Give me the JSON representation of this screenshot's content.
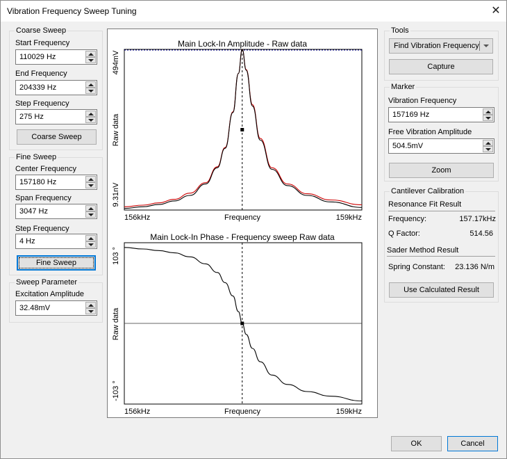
{
  "window": {
    "title": "Vibration Frequency Sweep Tuning",
    "close_glyph": "✕"
  },
  "coarse_sweep": {
    "title": "Coarse Sweep",
    "start_label": "Start Frequency",
    "start_value": "110029 Hz",
    "end_label": "End Frequency",
    "end_value": "204339 Hz",
    "step_label": "Step Frequency",
    "step_value": "275 Hz",
    "button": "Coarse Sweep"
  },
  "fine_sweep": {
    "title": "Fine Sweep",
    "center_label": "Center Frequency",
    "center_value": "157180 Hz",
    "span_label": "Span Frequency",
    "span_value": "3047 Hz",
    "step_label": "Step Frequency",
    "step_value": "4 Hz",
    "button": "Fine Sweep"
  },
  "sweep_parameter": {
    "title": "Sweep Parameter",
    "excitation_label": "Excitation Amplitude",
    "excitation_value": "32.48mV"
  },
  "tools": {
    "title": "Tools",
    "selected": "Find Vibration Frequency",
    "capture_button": "Capture"
  },
  "marker": {
    "title": "Marker",
    "vib_freq_label": "Vibration Frequency",
    "vib_freq_value": "157169 Hz",
    "free_amp_label": "Free Vibration Amplitude",
    "free_amp_value": "504.5mV",
    "zoom_button": "Zoom"
  },
  "cantilever": {
    "title": "Cantilever Calibration",
    "resonance_header": "Resonance Fit Result",
    "frequency_label": "Frequency:",
    "frequency_value": "157.17kHz",
    "q_label": "Q Factor:",
    "q_value": "514.56",
    "sader_header": "Sader Method Result",
    "spring_label": "Spring Constant:",
    "spring_value": "23.136 N/m",
    "use_button": "Use Calculated Result"
  },
  "footer": {
    "ok": "OK",
    "cancel": "Cancel"
  },
  "icons": {
    "close": "close-icon",
    "spin_up": "spin-up-icon",
    "spin_down": "spin-down-icon",
    "dropdown": "chevron-down-icon"
  },
  "colors": {
    "raw_trace": "#000000",
    "fit_trace": "#cc0000",
    "max_line": "#00008b",
    "focus": "#0078d7"
  },
  "chart_data": [
    {
      "type": "line",
      "title": "Main Lock-In Amplitude - Raw data",
      "xlabel": "Frequency",
      "ylabel": "Raw data",
      "x_ticks": [
        "156kHz",
        "Frequency",
        "159kHz"
      ],
      "y_ticks": [
        "494mV",
        "9.31nV"
      ],
      "xlim": [
        155.66,
        158.7
      ],
      "ylim": [
        0.0,
        494.0
      ],
      "marker_x": 157.169,
      "series": [
        {
          "color": "#000000",
          "x": [
            155.66,
            155.9,
            156.1,
            156.3,
            156.5,
            156.7,
            156.85,
            156.95,
            157.05,
            157.12,
            157.169,
            157.22,
            157.3,
            157.4,
            157.55,
            157.75,
            158.0,
            158.3,
            158.7
          ],
          "y": [
            5.0,
            10.0,
            17.0,
            28.0,
            45.0,
            80.0,
            130.0,
            190.0,
            300.0,
            420.0,
            494.0,
            430.0,
            320.0,
            215.0,
            125.0,
            75.0,
            45.0,
            25.0,
            8.0
          ]
        },
        {
          "color": "#cc0000",
          "x": [
            155.66,
            155.9,
            156.1,
            156.3,
            156.5,
            156.7,
            156.85,
            156.95,
            157.05,
            157.12,
            157.169,
            157.22,
            157.3,
            157.4,
            157.55,
            157.75,
            158.0,
            158.3,
            158.7
          ],
          "y": [
            10.0,
            15.0,
            22.0,
            33.0,
            52.0,
            84.0,
            133.0,
            192.0,
            302.0,
            420.0,
            494.0,
            432.0,
            324.0,
            220.0,
            130.0,
            80.0,
            50.0,
            31.0,
            16.0
          ]
        }
      ]
    },
    {
      "type": "line",
      "title": "Main Lock-In Phase - Frequency sweep   Raw data",
      "xlabel": "Frequency",
      "ylabel": "Raw data",
      "x_ticks": [
        "156kHz",
        "Frequency",
        "159kHz"
      ],
      "y_ticks": [
        "103 °",
        "-103 °"
      ],
      "xlim": [
        155.66,
        158.7
      ],
      "ylim": [
        -103.0,
        103.0
      ],
      "marker_x": 157.169,
      "series": [
        {
          "color": "#000000",
          "x": [
            155.66,
            155.9,
            156.1,
            156.3,
            156.5,
            156.7,
            156.85,
            156.95,
            157.05,
            157.12,
            157.169,
            157.22,
            157.3,
            157.4,
            157.55,
            157.75,
            158.0,
            158.3,
            158.7
          ],
          "y": [
            97.0,
            95.0,
            93.0,
            90.0,
            85.0,
            76.0,
            65.0,
            52.0,
            35.0,
            15.0,
            0.0,
            -14.0,
            -32.0,
            -49.0,
            -66.0,
            -78.0,
            -87.0,
            -93.0,
            -99.0
          ]
        }
      ]
    }
  ]
}
